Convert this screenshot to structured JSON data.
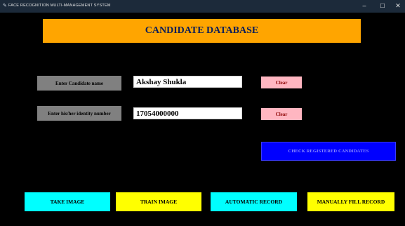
{
  "window": {
    "title": "FACE RECOGNITION MULTI-MANAGEMENT SYSTEM",
    "controls": {
      "minimize": "–",
      "maximize": "☐",
      "close": "✕"
    }
  },
  "header": {
    "title": "CANDIDATE DATABASE"
  },
  "form": {
    "name_label": "Enter Candidate name",
    "name_value": "Akshay Shukla",
    "id_label": "Enter his/her identity number",
    "id_value": "17054000000",
    "clear_label": "Clear"
  },
  "actions": {
    "check_registered": "CHECK REGISTERED CANDIDATES",
    "take_image": "TAKE IMAGE",
    "train_image": "TRAIN IMAGE",
    "automatic_record": "AUTOMATIC RECORD",
    "manual_record": "MANUALLY FILL RECORD"
  },
  "colors": {
    "background": "#000000",
    "header": "#ffa500",
    "label_box": "#808080",
    "clear_button": "#ffb6c1",
    "check_button": "#0000ff",
    "take_image": "#00ffff",
    "train_image": "#ffff00",
    "automatic_record": "#00ffff",
    "manual_record": "#ffff00"
  }
}
